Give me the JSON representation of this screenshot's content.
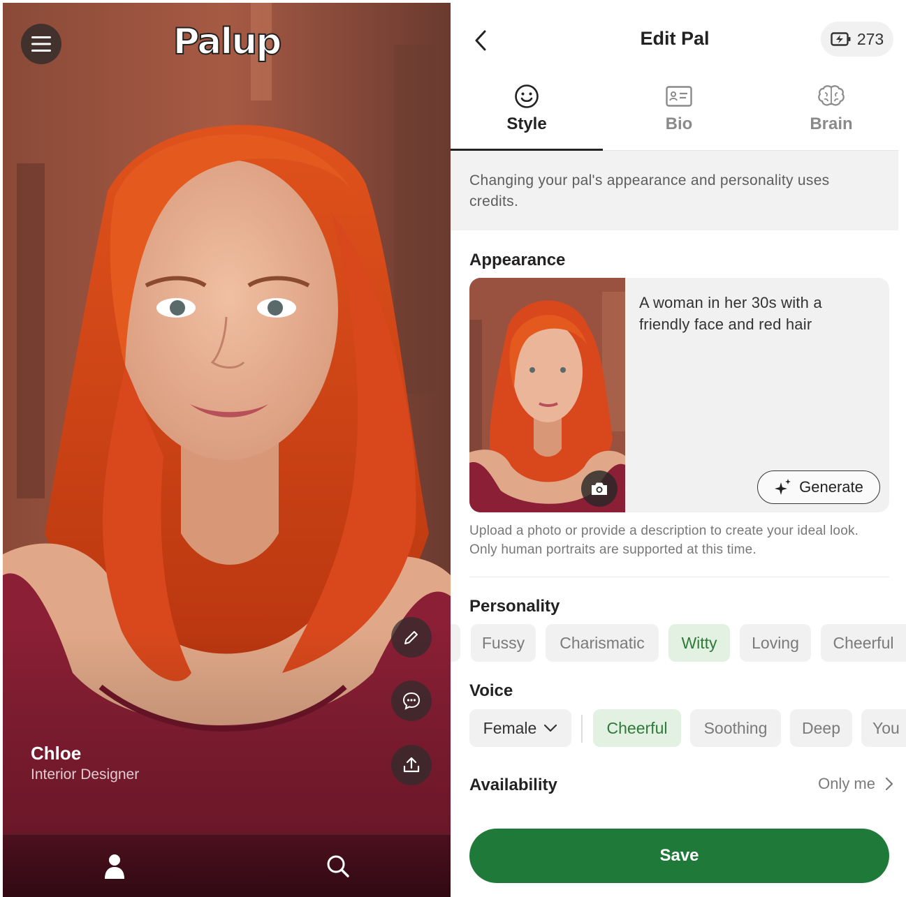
{
  "left_panel": {
    "logo": "Palup",
    "pal": {
      "name": "Chloe",
      "role": "Interior Designer"
    },
    "icons": [
      "menu-icon",
      "edit-icon",
      "chat-icon",
      "share-icon",
      "profile-icon",
      "search-icon"
    ]
  },
  "header": {
    "title": "Edit Pal",
    "credits": "273"
  },
  "tabs": [
    {
      "label": "Style",
      "icon": "smiley-icon",
      "active": true
    },
    {
      "label": "Bio",
      "icon": "id-card-icon",
      "active": false
    },
    {
      "label": "Brain",
      "icon": "brain-icon",
      "active": false
    }
  ],
  "notice": "Changing your pal's appearance and personality uses credits.",
  "appearance": {
    "label": "Appearance",
    "description": "A woman in her 30s with a friendly face and red hair",
    "generate_label": "Generate",
    "hint": "Upload a photo or provide a description to create your ideal look. Only human portraits are supported at this time."
  },
  "personality": {
    "label": "Personality",
    "traits": [
      "Fussy",
      "Charismatic",
      "Witty",
      "Loving",
      "Cheerful"
    ],
    "selected": "Witty"
  },
  "voice": {
    "label": "Voice",
    "gender": "Female",
    "tones": [
      "Cheerful",
      "Soothing",
      "Deep",
      "You"
    ],
    "selected": "Cheerful"
  },
  "availability": {
    "label": "Availability",
    "value": "Only me"
  },
  "save_label": "Save",
  "colors": {
    "accent_green": "#1f7a3a",
    "chip_selected_bg": "#e3f1e3",
    "chip_selected_text": "#2f7a38",
    "hair": "#d9481c",
    "top": "#8a1f35"
  }
}
